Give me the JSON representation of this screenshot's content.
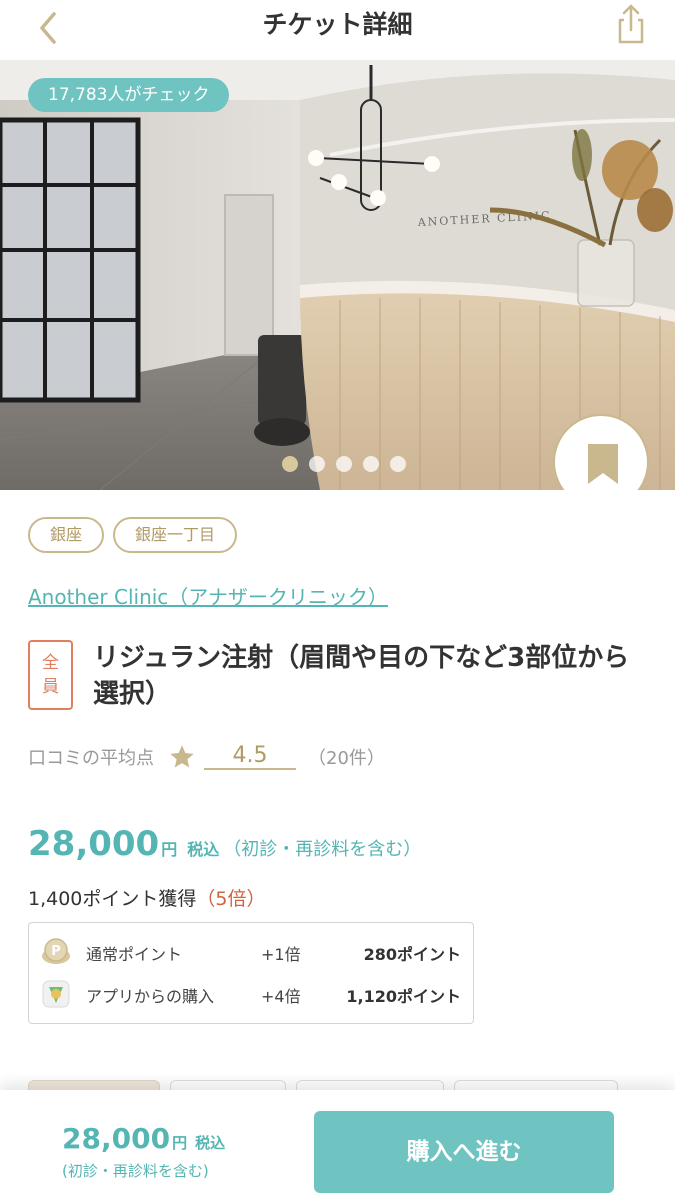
{
  "header": {
    "title": "チケット詳細",
    "back_icon": "chevron-left-icon",
    "share_icon": "share-icon",
    "icon_color": "#c9b88d"
  },
  "hero": {
    "check_count_label": "17,783人がチェック",
    "sign_text": "ANOTHER CLINIC",
    "carousel_page": 1,
    "carousel_total": 5,
    "bookmark_icon": "bookmark-icon"
  },
  "tags": [
    "銀座",
    "銀座一丁目"
  ],
  "clinic": {
    "name": "Another Clinic（アナザークリニック）"
  },
  "product": {
    "target_badge_line1": "全",
    "target_badge_line2": "員",
    "title": "リジュラン注射（眉間や目の下など3部位から選択）"
  },
  "rating": {
    "label": "口コミの平均点",
    "score": "4.5",
    "count": "（20件）"
  },
  "price": {
    "amount": "28,000",
    "yen": "円",
    "tax": "税込",
    "note": "（初診・再診料を含む）"
  },
  "points": {
    "total_label": "1,400ポイント獲得",
    "multiplier": "（5倍）",
    "rows": [
      {
        "icon": "point-coin-icon",
        "label": "通常ポイント",
        "rate": "+1倍",
        "value": "280ポイント"
      },
      {
        "icon": "app-icon",
        "label": "アプリからの購入",
        "rate": "+4倍",
        "value": "1,120ポイント"
      }
    ]
  },
  "bottom_bar": {
    "amount": "28,000",
    "yen": "円",
    "tax": "税込",
    "note": "(初診・再診料を含む)",
    "buy_label": "購入へ進む"
  },
  "colors": {
    "accent_teal": "#6fc4c2",
    "text_teal": "#54b5b3",
    "gold": "#c9b88d",
    "badge_orange": "#e07f5f"
  }
}
